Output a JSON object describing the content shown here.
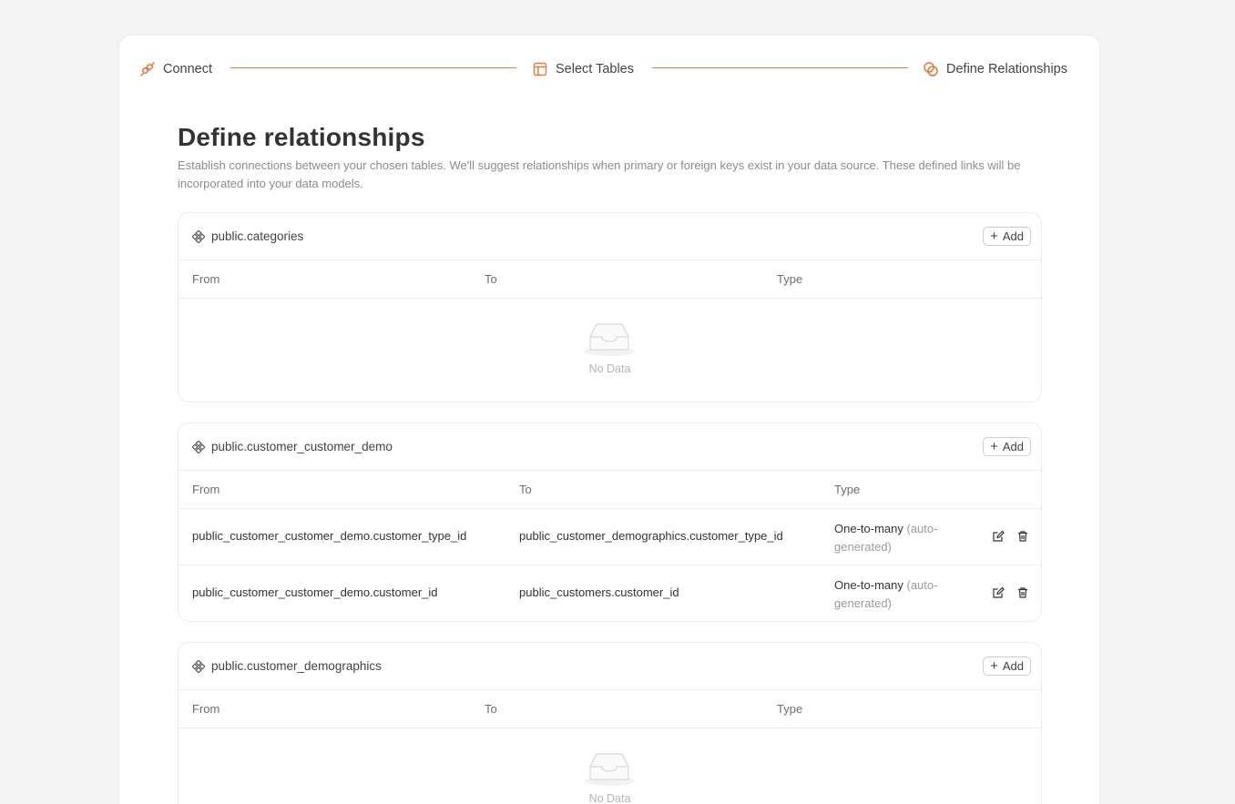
{
  "steps": [
    {
      "label": "Connect",
      "icon": "plug-icon"
    },
    {
      "label": "Select Tables",
      "icon": "table-icon"
    },
    {
      "label": "Define Relationships",
      "icon": "relationship-icon"
    }
  ],
  "colors": {
    "accent": "#e27a3a",
    "background": "#f3f3f3"
  },
  "page": {
    "title": "Define relationships",
    "description": "Establish connections between your chosen tables. We'll suggest relationships when primary or foreign keys exist in your data source. These defined links will be incorporated into your data models."
  },
  "columns": {
    "from": "From",
    "to": "To",
    "type": "Type"
  },
  "add_label": "Add",
  "empty_label": "No Data",
  "relations": [
    {
      "name": "public.categories",
      "rows": []
    },
    {
      "name": "public.customer_customer_demo",
      "rows": [
        {
          "from": "public_customer_customer_demo.customer_type_id",
          "to": "public_customer_demographics.customer_type_id",
          "type": "One-to-many",
          "note": "(auto-generated)"
        },
        {
          "from": "public_customer_customer_demo.customer_id",
          "to": "public_customers.customer_id",
          "type": "One-to-many",
          "note": "(auto-generated)"
        }
      ]
    },
    {
      "name": "public.customer_demographics",
      "rows": []
    }
  ]
}
